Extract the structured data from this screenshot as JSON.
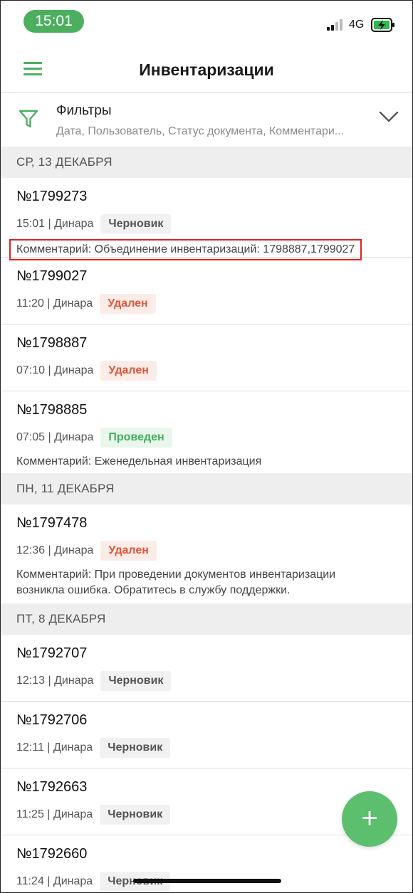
{
  "status_bar": {
    "time": "15:01",
    "network": "4G"
  },
  "header": {
    "title": "Инвентаризации"
  },
  "filters": {
    "title": "Фильтры",
    "subtitle": "Дата, Пользователь, Статус документа, Комментари..."
  },
  "groups": [
    {
      "date": "СР, 13 ДЕКАБРЯ",
      "docs": [
        {
          "number": "№1799273",
          "meta": "15:01 | Динара",
          "status": "Черновик",
          "status_kind": "draft",
          "comment": "Комментарий: Объединение инвентаризаций: 1798887,1799027"
        },
        {
          "number": "№1799027",
          "meta": "11:20 | Динара",
          "status": "Удален",
          "status_kind": "deleted"
        },
        {
          "number": "№1798887",
          "meta": "07:10 | Динара",
          "status": "Удален",
          "status_kind": "deleted"
        },
        {
          "number": "№1798885",
          "meta": "07:05 | Динара",
          "status": "Проведен",
          "status_kind": "done",
          "comment": "Комментарий: Еженедельная инвентаризация"
        }
      ]
    },
    {
      "date": "ПН, 11 ДЕКАБРЯ",
      "docs": [
        {
          "number": "№1797478",
          "meta": "12:36 | Динара",
          "status": "Удален",
          "status_kind": "deleted",
          "comment_line1": "Комментарий: При проведении документов инвентаризации",
          "comment_line2": "возникла ошибка. Обратитесь в службу поддержки."
        }
      ]
    },
    {
      "date": "ПТ, 8 ДЕКАБРЯ",
      "docs": [
        {
          "number": "№1792707",
          "meta": "12:13 | Динара",
          "status": "Черновик",
          "status_kind": "draft"
        },
        {
          "number": "№1792706",
          "meta": "12:11 | Динара",
          "status": "Черновик",
          "status_kind": "draft"
        },
        {
          "number": "№1792663",
          "meta": "11:25 | Динара",
          "status": "Черновик",
          "status_kind": "draft"
        },
        {
          "number": "№1792660",
          "meta": "11:24 | Динара",
          "status": "Черновик",
          "status_kind": "draft"
        }
      ]
    }
  ],
  "fab": {
    "label": "+"
  },
  "colors": {
    "accent": "#4caf60",
    "deleted": "#e0573a",
    "done": "#42b05f",
    "highlight_box": "#e0201f"
  },
  "icons": [
    "menu-icon",
    "filter-icon",
    "chevron-down-icon",
    "signal-icon",
    "battery-charging-icon",
    "plus-icon"
  ]
}
